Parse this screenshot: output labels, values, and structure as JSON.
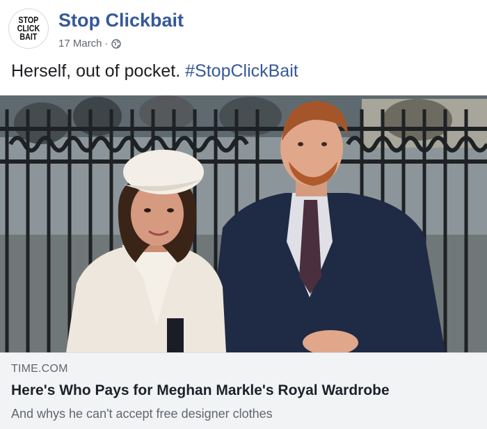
{
  "post": {
    "page_name": "Stop Clickbait",
    "avatar_logo": [
      "STOP",
      "CLICK",
      "BAIT"
    ],
    "date": "17 March",
    "separator": "·",
    "privacy_icon": "globe-icon",
    "caption_text": "Herself, out of pocket.",
    "caption_hashtag": "#StopClickBait"
  },
  "link_preview": {
    "domain": "TIME.COM",
    "title": "Here's Who Pays for Meghan Markle's Royal Wardrobe",
    "description": "And whys he can't accept free designer clothes"
  },
  "colors": {
    "link_blue": "#365899",
    "meta_gray": "#616770",
    "preview_bg": "#f2f3f5"
  }
}
